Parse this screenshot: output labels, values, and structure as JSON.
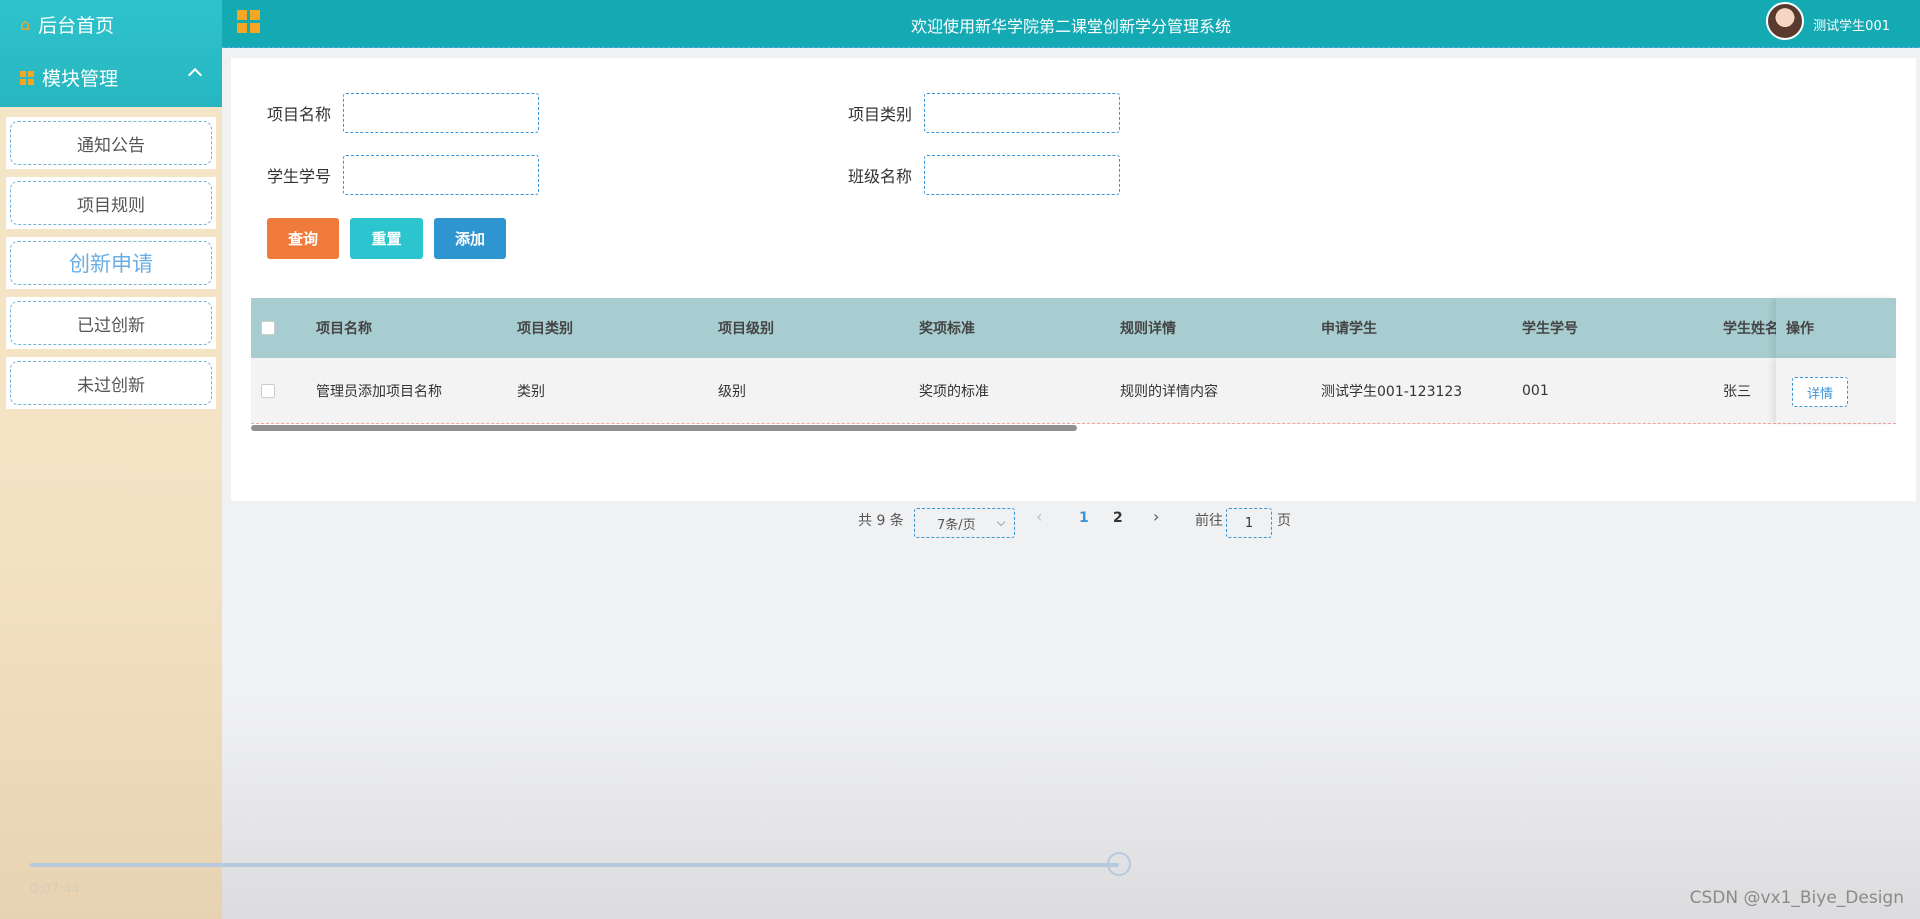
{
  "sidebar": {
    "home_label": "后台首页",
    "module_label": "模块管理",
    "items": [
      {
        "label": "通知公告"
      },
      {
        "label": "项目规则"
      },
      {
        "label": "创新申请"
      },
      {
        "label": "已过创新"
      },
      {
        "label": "未过创新"
      }
    ],
    "active_item": "创新申请"
  },
  "topbar": {
    "title": "欢迎使用新华学院第二课堂创新学分管理系统",
    "user_name": "测试学生001"
  },
  "filters": {
    "project_name_label": "项目名称",
    "project_category_label": "项目类别",
    "student_id_label": "学生学号",
    "class_name_label": "班级名称",
    "project_name_value": "",
    "project_category_value": "",
    "student_id_value": "",
    "class_name_value": ""
  },
  "buttons": {
    "search": "查询",
    "reset": "重置",
    "add": "添加"
  },
  "table": {
    "headers": [
      "项目名称",
      "项目类别",
      "项目级别",
      "奖项标准",
      "规则详情",
      "申请学生",
      "学生学号",
      "学生姓名",
      "操作"
    ],
    "rows": [
      {
        "project_name": "管理员添加项目名称",
        "category": "类别",
        "level": "级别",
        "award_standard": "奖项的标准",
        "rule_detail": "规则的详情内容",
        "applicant": "测试学生001-123123",
        "student_id": "001",
        "student_name": "张三",
        "action": "详情"
      }
    ]
  },
  "pagination": {
    "total_text": "共 9 条",
    "page_size": "7条/页",
    "pages": [
      "1",
      "2"
    ],
    "current_page": "1",
    "goto_label": "前往",
    "goto_value": "1",
    "page_suffix": "页",
    "prev_icon": "‹",
    "next_icon": "›"
  },
  "video": {
    "time": "0:07:44",
    "progress": 0.58
  },
  "watermark": "CSDN @vx1_Biye_Design",
  "colors": {
    "topbar": "#13aab4",
    "search_button": "#f07a3a",
    "reset_button": "#2cc5cf",
    "add_button": "#2f95d0",
    "table_header": "#a8cdd0",
    "active_menu_text": "#6aaee6"
  }
}
